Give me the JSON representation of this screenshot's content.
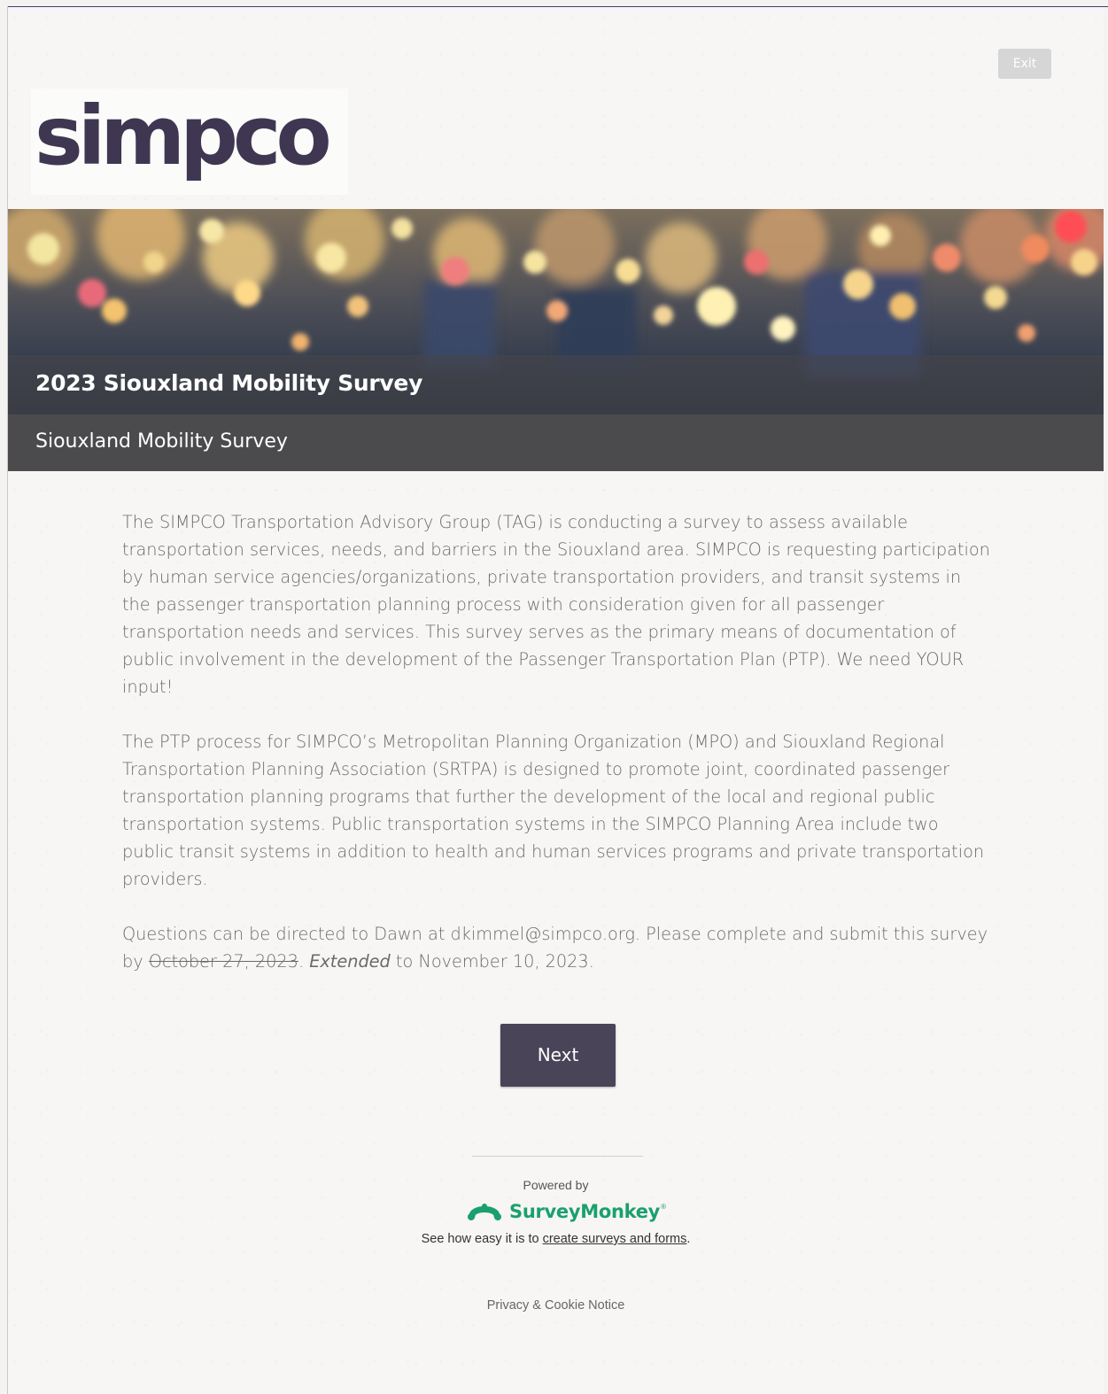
{
  "header": {
    "exit_label": "Exit",
    "logo_text": "simpco"
  },
  "banner": {
    "title": "2023 Siouxland Mobility Survey"
  },
  "page": {
    "subtitle": "Siouxland Mobility Survey"
  },
  "intro": {
    "paragraph1": "The SIMPCO Transportation Advisory Group (TAG) is conducting a survey to assess available transportation services, needs, and barriers in the Siouxland area. SIMPCO is requesting participation by human service agencies/organizations, private transportation providers, and transit systems in the passenger transportation planning process with consideration given for all passenger transportation needs and services. This survey serves as the primary means of documentation of public involvement in the development of the Passenger Transportation Plan (PTP). We need YOUR input!",
    "paragraph2": "The PTP process for SIMPCO’s Metropolitan Planning Organization (MPO) and Siouxland Regional Transportation Planning Association (SRTPA) is designed to promote joint, coordinated passenger transportation planning programs that further the development of the local and regional public transportation systems. Public transportation systems in the SIMPCO Planning Area include two public transit systems in addition to health and human services programs and private transportation providers.",
    "paragraph3_a": "Questions can be directed to Dawn at dkimmel@simpco.org. Please complete and submit this survey by ",
    "paragraph3_struck": "October 27, 2023",
    "paragraph3_b": ". ",
    "paragraph3_italic": "Extended",
    "paragraph3_c": " to November 10, 2023."
  },
  "navigation": {
    "next_label": "Next"
  },
  "footer": {
    "powered_by": "Powered by",
    "brand": "SurveyMonkey",
    "brand_mark": "®",
    "see_how_prefix": "See how easy it is to ",
    "see_how_link": "create surveys and forms",
    "see_how_suffix": ".",
    "privacy": "Privacy & Cookie Notice"
  },
  "colors": {
    "logo": "#3f3752",
    "next_button": "#4a4458",
    "subtitle_bar": "#4b4b4d",
    "brand_green": "#1aa06f"
  }
}
